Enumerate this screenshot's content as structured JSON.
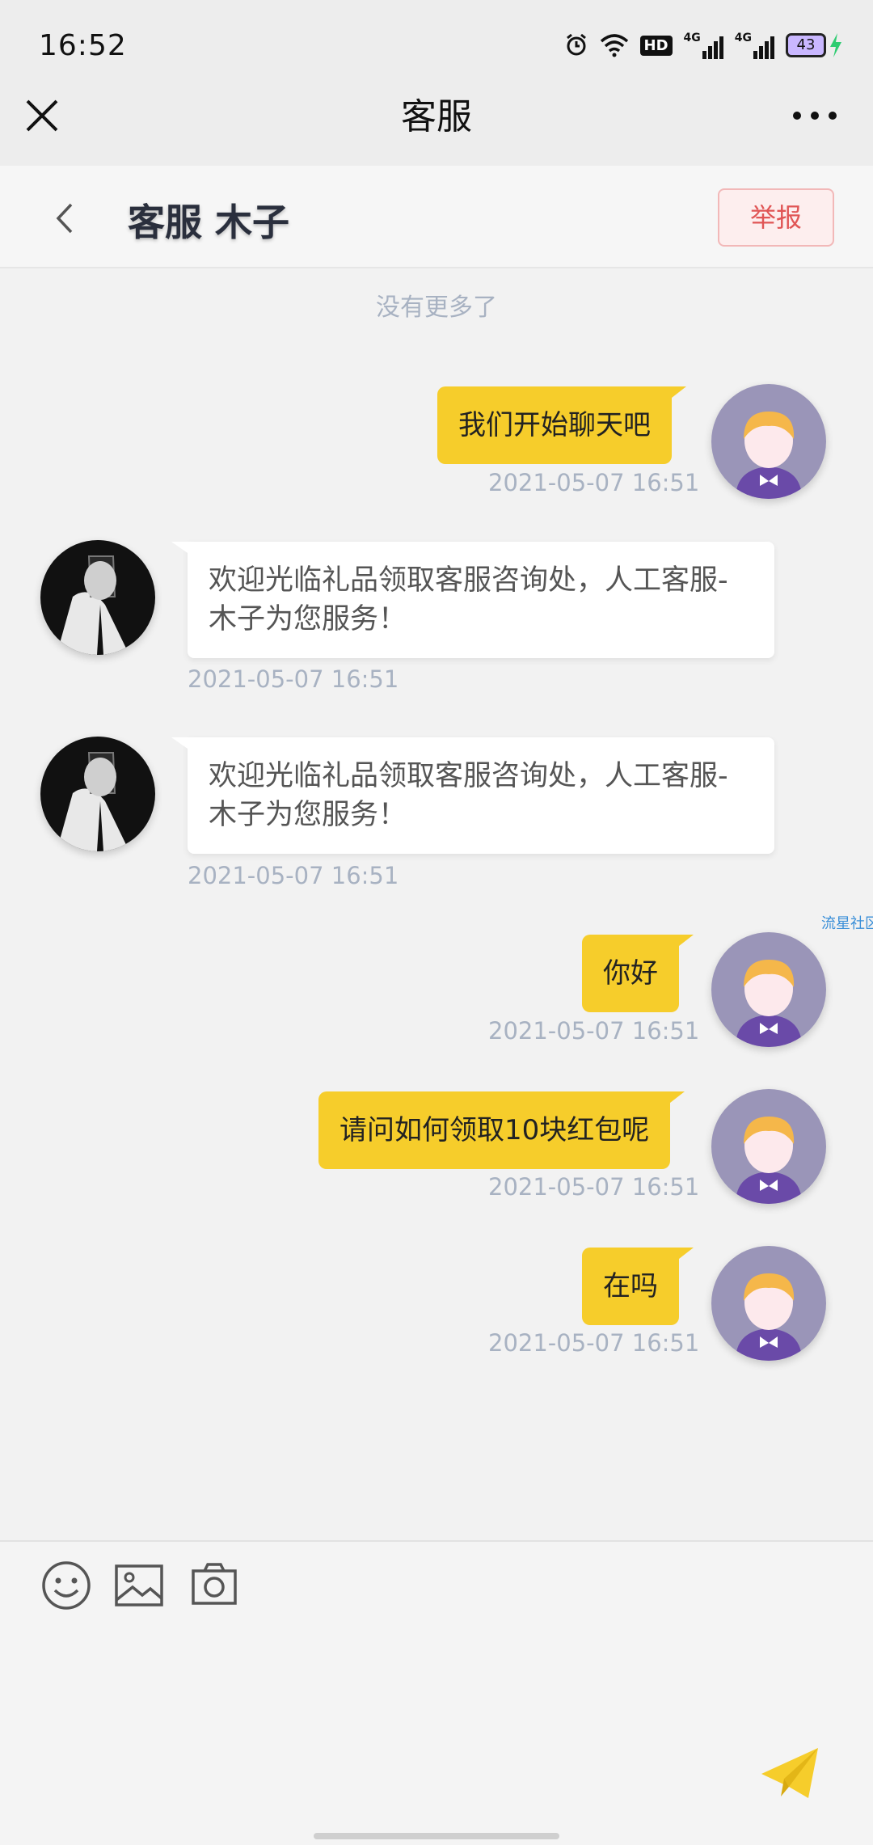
{
  "status_bar": {
    "time": "16:52",
    "icons": [
      "alarm-icon",
      "wifi-icon",
      "hd-icon",
      "signal-4g-icon",
      "signal-4g-icon",
      "battery-icon",
      "charging-icon"
    ],
    "battery_level": "43",
    "hd_label": "HD",
    "net_label": "4G"
  },
  "title_bar": {
    "title": "客服",
    "close_icon": "close-icon",
    "more_icon": "more-icon"
  },
  "chat_header": {
    "agent_name": "客服 木子",
    "report_label": "举报"
  },
  "chat": {
    "no_more_text": "没有更多了",
    "watermark": "流星社区",
    "messages": [
      {
        "side": "right",
        "text": "我们开始聊天吧",
        "time": "2021-05-07 16:51"
      },
      {
        "side": "left",
        "text": "欢迎光临礼品领取客服咨询处，人工客服-木子为您服务！",
        "time": "2021-05-07 16:51"
      },
      {
        "side": "left",
        "text": "欢迎光临礼品领取客服咨询处，人工客服-木子为您服务！",
        "time": "2021-05-07 16:51"
      },
      {
        "side": "right",
        "text": "你好",
        "time": "2021-05-07 16:51"
      },
      {
        "side": "right",
        "text": "请问如何领取10块红包呢",
        "time": "2021-05-07 16:51"
      },
      {
        "side": "right",
        "text": "在吗",
        "time": "2021-05-07 16:51"
      }
    ]
  },
  "composer": {
    "tools": [
      "emoji-icon",
      "image-icon",
      "camera-icon"
    ],
    "send_icon": "send-icon",
    "colors": {
      "send": "#f6cd2b",
      "bubble_self": "#f6cd2b"
    }
  }
}
